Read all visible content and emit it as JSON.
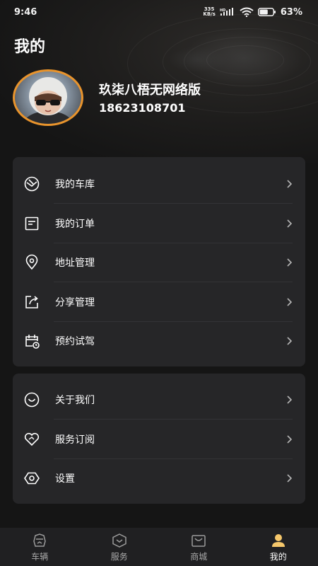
{
  "status_bar": {
    "time": "9:46",
    "net_speed_value": "335",
    "net_speed_unit": "KB/s",
    "network": "HD",
    "battery": "63%",
    "battery_level": 0.63
  },
  "page": {
    "title": "我的"
  },
  "profile": {
    "nickname": "玖柒八梧无网络版",
    "phone": "18623108701"
  },
  "menu_group_1": [
    {
      "label": "我的车库",
      "icon": "garage-icon"
    },
    {
      "label": "我的订单",
      "icon": "order-icon"
    },
    {
      "label": "地址管理",
      "icon": "location-pin-icon"
    },
    {
      "label": "分享管理",
      "icon": "share-icon"
    },
    {
      "label": "预约试驾",
      "icon": "calendar-clock-icon"
    }
  ],
  "menu_group_2": [
    {
      "label": "关于我们",
      "icon": "smile-icon"
    },
    {
      "label": "服务订阅",
      "icon": "heart-icon"
    },
    {
      "label": "设置",
      "icon": "settings-hexagon-icon"
    }
  ],
  "tabbar": [
    {
      "label": "车辆",
      "icon": "car-tab-icon",
      "active": false
    },
    {
      "label": "服务",
      "icon": "service-tab-icon",
      "active": false
    },
    {
      "label": "商城",
      "icon": "mall-tab-icon",
      "active": false
    },
    {
      "label": "我的",
      "icon": "profile-tab-icon",
      "active": true
    }
  ],
  "colors": {
    "background": "#151515",
    "card": "#262628",
    "accent_ring": "#e9942c",
    "active_tab_icon": "#f5c76b"
  }
}
